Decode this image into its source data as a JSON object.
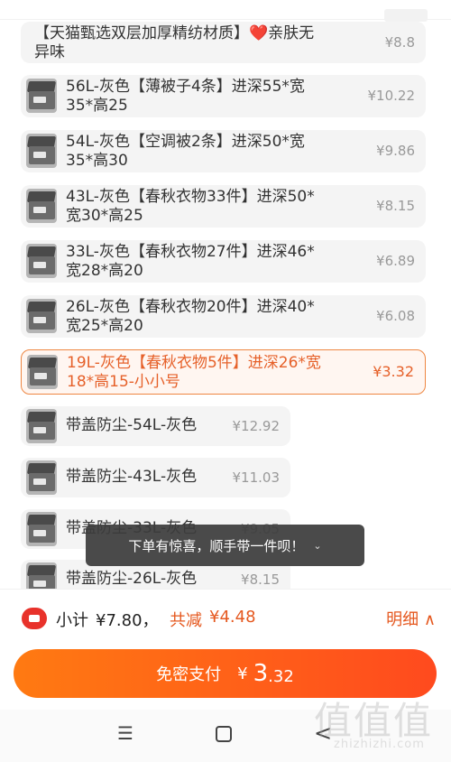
{
  "sku_options": [
    {
      "name": "【天猫甄选双层加厚精纺材质】❤️亲肤无\n异味",
      "price": "¥8.8",
      "selected": false,
      "has_thumb": false
    },
    {
      "name": "56L-灰色【薄被子4条】进深55*宽\n35*高25",
      "price": "¥10.22",
      "selected": false,
      "has_thumb": true
    },
    {
      "name": "54L-灰色【空调被2条】进深50*宽\n35*高30",
      "price": "¥9.86",
      "selected": false,
      "has_thumb": true
    },
    {
      "name": "43L-灰色【春秋衣物33件】进深50*\n宽30*高25",
      "price": "¥8.15",
      "selected": false,
      "has_thumb": true
    },
    {
      "name": "33L-灰色【春秋衣物27件】进深46*\n宽28*高20",
      "price": "¥6.89",
      "selected": false,
      "has_thumb": true
    },
    {
      "name": "26L-灰色【春秋衣物20件】进深40*\n宽25*高20",
      "price": "¥6.08",
      "selected": false,
      "has_thumb": true
    },
    {
      "name": "19L-灰色【春秋衣物5件】进深26*宽\n18*高15-小小号",
      "price": "¥3.32",
      "selected": true,
      "has_thumb": true
    },
    {
      "name": "带盖防尘-54L-灰色",
      "price": "¥12.92",
      "selected": false,
      "has_thumb": true
    },
    {
      "name": "带盖防尘-43L-灰色",
      "price": "¥11.03",
      "selected": false,
      "has_thumb": true
    },
    {
      "name": "带盖防尘-33L-灰色",
      "price": "¥9.05",
      "selected": false,
      "has_thumb": true
    },
    {
      "name": "带盖防尘-26L-灰色",
      "price": "¥8.15",
      "selected": false,
      "has_thumb": true
    }
  ],
  "toast": {
    "text": "下单有惊喜，顺手带一件呗！",
    "icon": "chevron-double-down-icon",
    "glyph": "⌄"
  },
  "subtotal": {
    "label": "小计",
    "amount": "¥7.80，",
    "discount_label": "共减",
    "discount_amount": "¥4.48",
    "detail_label": "明细 ∧"
  },
  "pay_button": {
    "label": "免密支付",
    "currency": "¥",
    "amount_int": "3",
    "amount_dec": ".32"
  },
  "nav": {
    "menu_glyph": "☰",
    "back_glyph": "<"
  },
  "watermark": {
    "glyphs": "值值值",
    "url": "zhizhizhi.com"
  },
  "colors": {
    "accent": "#e5581f",
    "pay_gradient_start": "#ff7a12",
    "pay_gradient_end": "#ff4a1e",
    "coupon_red": "#e8322b"
  }
}
